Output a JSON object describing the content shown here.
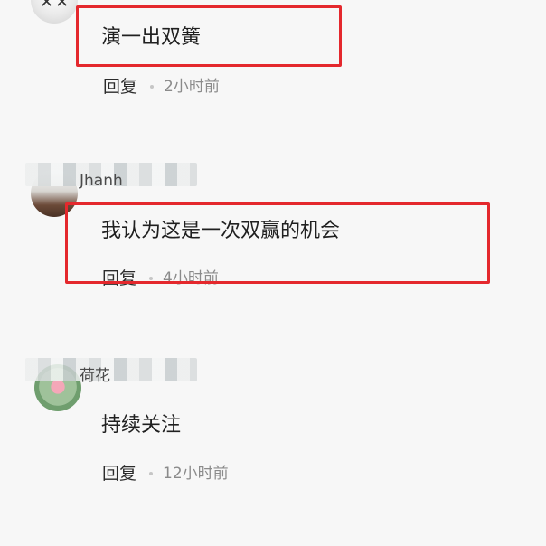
{
  "comments": [
    {
      "avatar": "avatar-round-sticker",
      "content": "演一出双簧",
      "reply_label": "回复",
      "time": "2小时前",
      "highlighted": true
    },
    {
      "avatar": "avatar-person-photo",
      "username": "Jhanh",
      "content": "我认为这是一次双赢的机会",
      "reply_label": "回复",
      "time": "4小时前",
      "highlighted": true
    },
    {
      "avatar": "avatar-lotus-image",
      "username": "荷花",
      "content": "持续关注",
      "reply_label": "回复",
      "time": "12小时前",
      "highlighted": false
    }
  ],
  "colors": {
    "highlight_border": "#e4282d",
    "background": "#f7f7f7"
  }
}
